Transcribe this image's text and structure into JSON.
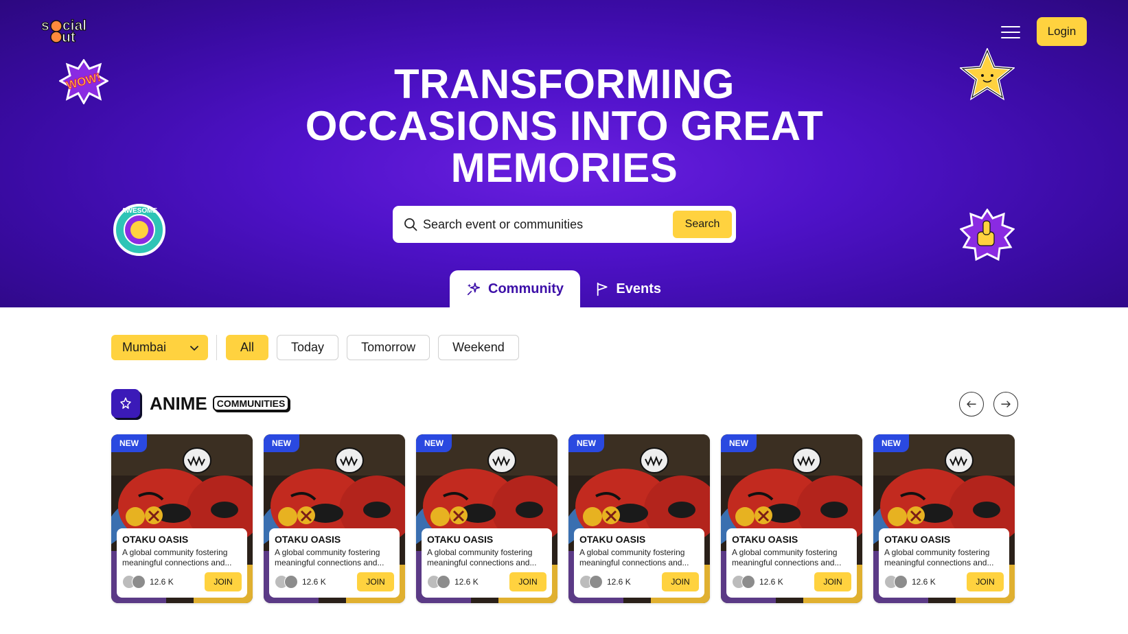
{
  "brand": {
    "logo_text": "social out"
  },
  "header": {
    "login_label": "Login"
  },
  "hero": {
    "headline_line1": "TRANSFORMING",
    "headline_line2": "OCCASIONS INTO GREAT",
    "headline_line3": "MEMORIES"
  },
  "search": {
    "placeholder": "Search event or communities",
    "button_label": "Search"
  },
  "tabs": [
    {
      "label": "Community",
      "active": true
    },
    {
      "label": "Events",
      "active": false
    }
  ],
  "stickers": {
    "top_left": "WOW!",
    "bottom_left": "AWESOME",
    "top_right": "star",
    "bottom_right": "thumbs-up"
  },
  "filters": {
    "city": "Mumbai",
    "chips": [
      {
        "label": "All",
        "active": true
      },
      {
        "label": "Today",
        "active": false
      },
      {
        "label": "Tomorrow",
        "active": false
      },
      {
        "label": "Weekend",
        "active": false
      }
    ]
  },
  "section": {
    "title": "ANIME",
    "badge": "COMMUNITIES"
  },
  "cards": [
    {
      "badge": "NEW",
      "title": "OTAKU OASIS",
      "description": "A global community fostering meaningful connections and...",
      "members": "12.6 K",
      "join_label": "JOIN"
    },
    {
      "badge": "NEW",
      "title": "OTAKU OASIS",
      "description": "A global community fostering meaningful connections and...",
      "members": "12.6 K",
      "join_label": "JOIN"
    },
    {
      "badge": "NEW",
      "title": "OTAKU OASIS",
      "description": "A global community fostering meaningful connections and...",
      "members": "12.6 K",
      "join_label": "JOIN"
    },
    {
      "badge": "NEW",
      "title": "OTAKU OASIS",
      "description": "A global community fostering meaningful connections and...",
      "members": "12.6 K",
      "join_label": "JOIN"
    },
    {
      "badge": "NEW",
      "title": "OTAKU OASIS",
      "description": "A global community fostering meaningful connections and...",
      "members": "12.6 K",
      "join_label": "JOIN"
    },
    {
      "badge": "NEW",
      "title": "OTAKU OASIS",
      "description": "A global community fostering meaningful connections and...",
      "members": "12.6 K",
      "join_label": "JOIN"
    }
  ],
  "colors": {
    "hero_purple": "#4f12c9",
    "accent_yellow": "#ffd23f",
    "new_badge_blue": "#2a49e0"
  }
}
